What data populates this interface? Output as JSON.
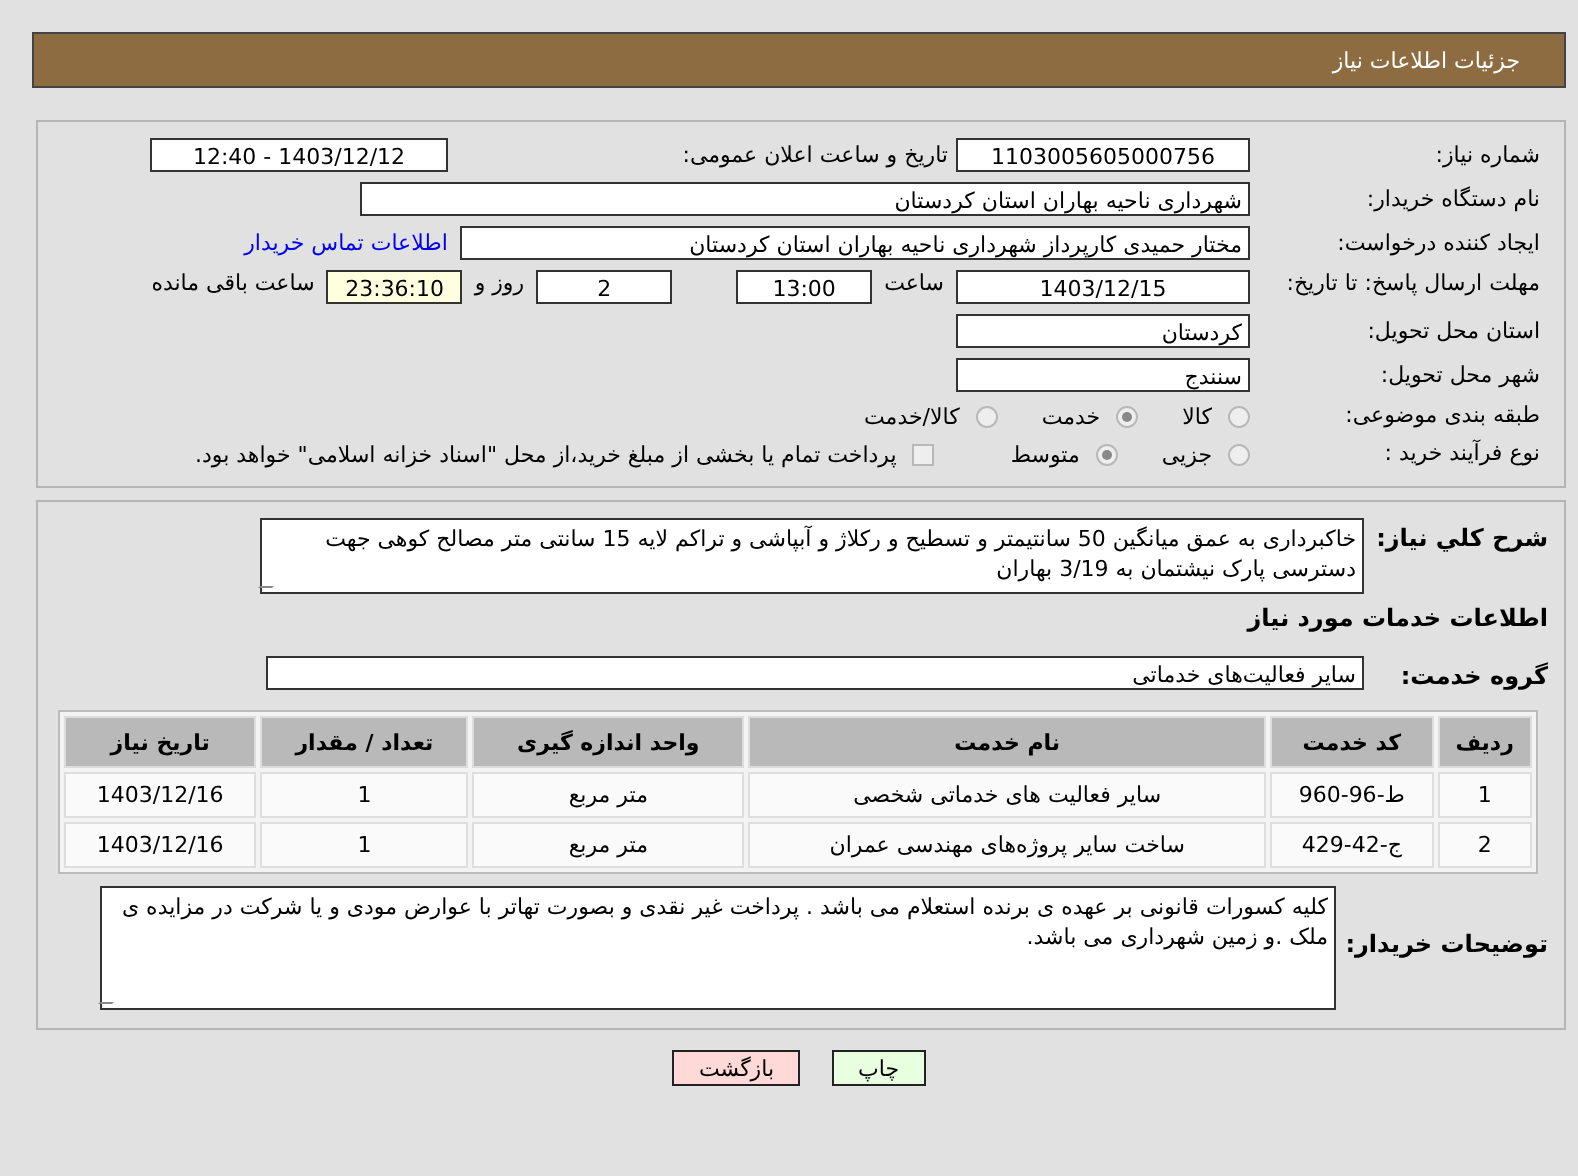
{
  "header": {
    "title": "جزئیات اطلاعات نیاز"
  },
  "need_number": {
    "label": "شماره نیاز:",
    "value": "1103005605000756"
  },
  "announce": {
    "label": "تاریخ و ساعت اعلان عمومی:",
    "value": "1403/12/12 - 12:40"
  },
  "buyer": {
    "label": "نام دستگاه خریدار:",
    "value": "شهرداری ناحیه بهاران استان کردستان"
  },
  "creator": {
    "label": "ایجاد کننده درخواست:",
    "value": "مختار حمیدی کارپرداز شهرداری ناحیه بهاران استان کردستان",
    "link": "اطلاعات تماس خریدار"
  },
  "deadline": {
    "label": "مهلت ارسال پاسخ: تا تاریخ:",
    "date": "1403/12/15",
    "time_label": "ساعت",
    "time": "13:00",
    "days": "2",
    "days_label": "روز و",
    "remaining": "23:36:10",
    "remaining_label": "ساعت باقی مانده"
  },
  "province": {
    "label": "استان محل تحویل:",
    "value": "کردستان"
  },
  "city": {
    "label": "شهر محل تحویل:",
    "value": "سنندج"
  },
  "category": {
    "label": "طبقه بندی موضوعی:",
    "options": [
      {
        "label": "کالا",
        "selected": false
      },
      {
        "label": "خدمت",
        "selected": true
      },
      {
        "label": "کالا/خدمت",
        "selected": false
      }
    ]
  },
  "process": {
    "label": "نوع فرآیند خرید :",
    "options": [
      {
        "label": "جزیی",
        "selected": false
      },
      {
        "label": "متوسط",
        "selected": true
      }
    ],
    "checkbox": {
      "label": "پرداخت تمام یا بخشی از مبلغ خرید،از محل \"اسناد خزانه اسلامی\" خواهد بود.",
      "checked": false
    }
  },
  "description": {
    "label": "شرح کلي نياز:",
    "value": "خاکبرداری به عمق میانگین 50 سانتیمتر و تسطیح و رکلاژ و آبپاشی و تراکم لایه 15 سانتی متر مصالح کوهی جهت دسترسی پارک نیشتمان به 3/19 بهاران"
  },
  "services_title": "اطلاعات خدمات مورد نياز",
  "service_group": {
    "label": "گروه خدمت:",
    "value": "سایر فعالیت‌های خدماتی"
  },
  "table": {
    "columns": [
      "ردیف",
      "کد خدمت",
      "نام خدمت",
      "واحد اندازه گیری",
      "تعداد / مقدار",
      "تاریخ نیاز"
    ],
    "rows": [
      [
        "1",
        "ط-96-960",
        "سایر فعالیت های خدماتی شخصی",
        "متر مربع",
        "1",
        "1403/12/16"
      ],
      [
        "2",
        "ج-42-429",
        "ساخت سایر پروژه‌های مهندسی عمران",
        "متر مربع",
        "1",
        "1403/12/16"
      ]
    ]
  },
  "buyer_notes": {
    "label": "توضیحات خریدار:",
    "value": "کلیه کسورات قانونی بر عهده ی برنده استعلام می باشد . پرداخت غیر نقدی و بصورت تهاتر با عوارض مودی و یا شرکت در مزایده ی ملک .و زمین شهرداری می باشد."
  },
  "buttons": [
    {
      "label": "چاپ",
      "kind": "print"
    },
    {
      "label": "بازگشت",
      "kind": "back"
    }
  ]
}
